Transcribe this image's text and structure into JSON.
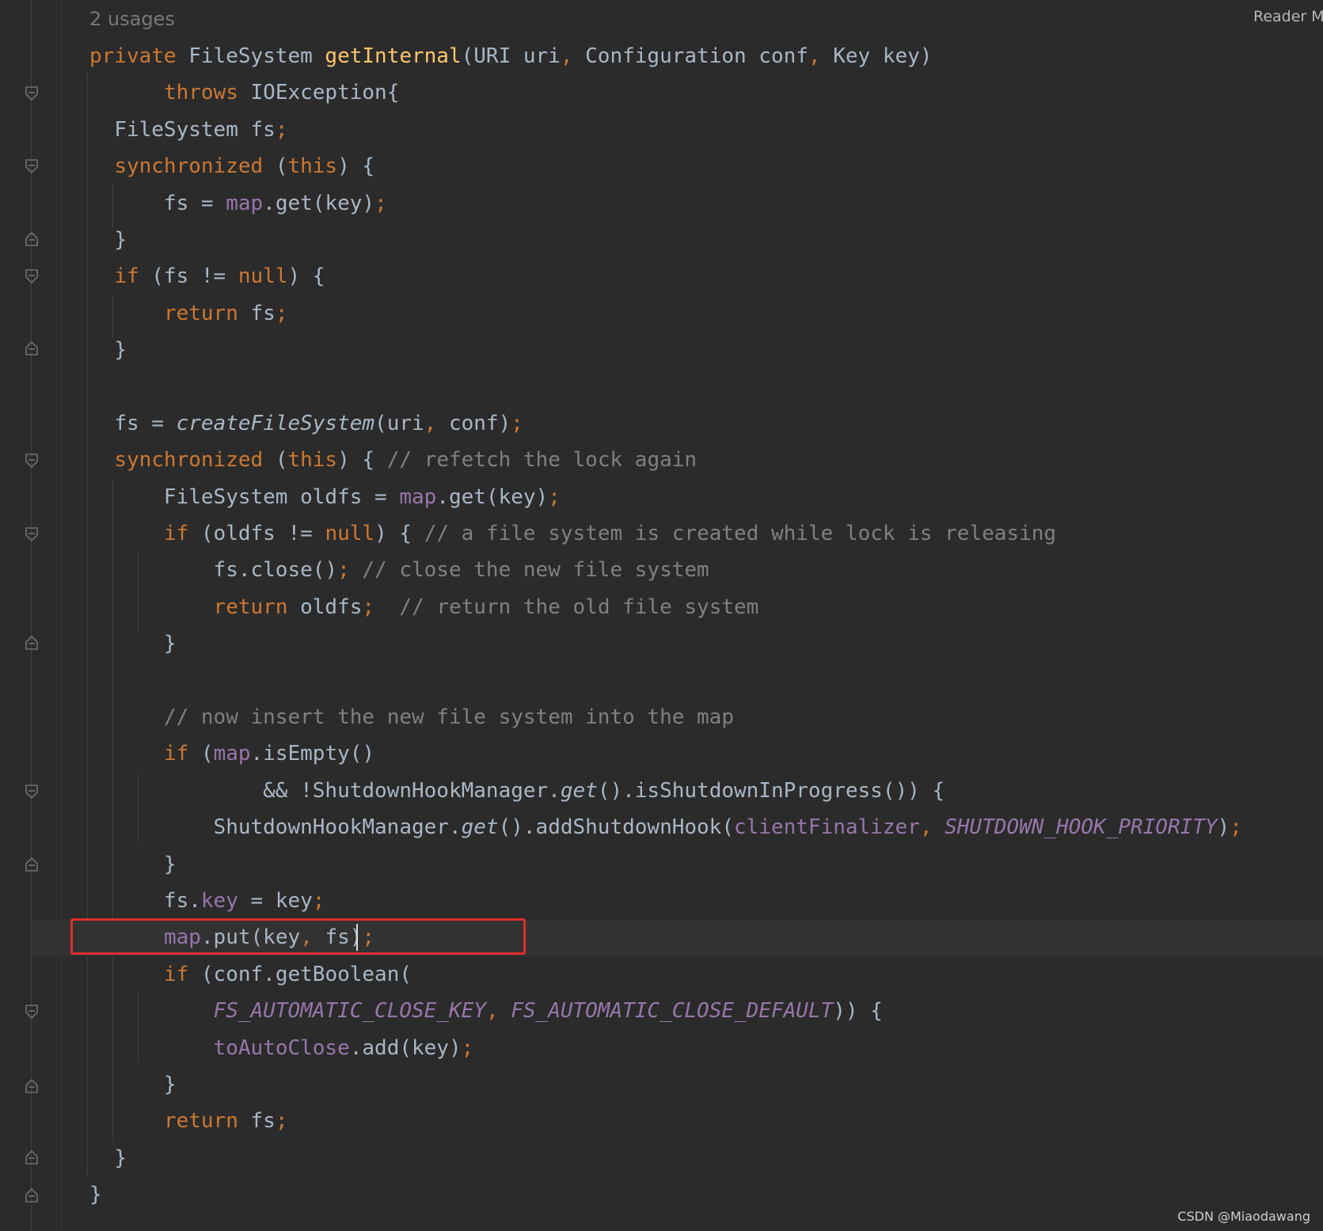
{
  "header": {
    "usages": "2 usages",
    "reader_mode": "Reader Mo"
  },
  "watermark": "CSDN @Miaodawang",
  "highlight": {
    "color": "#e02d2d",
    "line_text": "map.put(key, fs);"
  },
  "colors": {
    "background": "#2b2b2b",
    "keyword": "#cc7832",
    "method_decl": "#ffc66d",
    "field": "#9876aa",
    "comment": "#808080",
    "text": "#a9b7c6"
  },
  "code_lines": [
    [
      [
        "kw",
        "private "
      ],
      [
        "tx",
        "FileSystem "
      ],
      [
        "fn",
        "getInternal"
      ],
      [
        "tx",
        "(URI uri"
      ],
      [
        "pn",
        ", "
      ],
      [
        "tx",
        "Configuration conf"
      ],
      [
        "pn",
        ", "
      ],
      [
        "tx",
        "Key key)"
      ]
    ],
    [
      [
        "tx",
        "  "
      ],
      [
        "kw",
        "throws "
      ],
      [
        "tx",
        "IOException{"
      ]
    ],
    [
      [
        "tx",
        "FileSystem fs"
      ],
      [
        "pn",
        ";"
      ]
    ],
    [
      [
        "kw",
        "synchronized "
      ],
      [
        "tx",
        "("
      ],
      [
        "kw",
        "this"
      ],
      [
        "tx",
        ") {"
      ]
    ],
    [
      [
        "tx",
        "  fs = "
      ],
      [
        "fld",
        "map"
      ],
      [
        "tx",
        ".get(key)"
      ],
      [
        "pn",
        ";"
      ]
    ],
    [
      [
        "tx",
        "}"
      ]
    ],
    [
      [
        "kw",
        "if "
      ],
      [
        "tx",
        "(fs != "
      ],
      [
        "kw",
        "null"
      ],
      [
        "tx",
        ") {"
      ]
    ],
    [
      [
        "tx",
        "  "
      ],
      [
        "kw",
        "return "
      ],
      [
        "tx",
        "fs"
      ],
      [
        "pn",
        ";"
      ]
    ],
    [
      [
        "tx",
        "}"
      ]
    ],
    [],
    [
      [
        "tx",
        "fs = "
      ],
      [
        "it",
        "createFileSystem"
      ],
      [
        "tx",
        "(uri"
      ],
      [
        "pn",
        ", "
      ],
      [
        "tx",
        "conf)"
      ],
      [
        "pn",
        ";"
      ]
    ],
    [
      [
        "kw",
        "synchronized "
      ],
      [
        "tx",
        "("
      ],
      [
        "kw",
        "this"
      ],
      [
        "tx",
        ") { "
      ],
      [
        "cm",
        "// refetch the lock again"
      ]
    ],
    [
      [
        "tx",
        "  FileSystem oldfs = "
      ],
      [
        "fld",
        "map"
      ],
      [
        "tx",
        ".get(key)"
      ],
      [
        "pn",
        ";"
      ]
    ],
    [
      [
        "tx",
        "  "
      ],
      [
        "kw",
        "if "
      ],
      [
        "tx",
        "(oldfs != "
      ],
      [
        "kw",
        "null"
      ],
      [
        "tx",
        ") { "
      ],
      [
        "cm",
        "// a file system is created while lock is releasing"
      ]
    ],
    [
      [
        "tx",
        "    fs.close()"
      ],
      [
        "pn",
        "; "
      ],
      [
        "cm",
        "// close the new file system"
      ]
    ],
    [
      [
        "tx",
        "    "
      ],
      [
        "kw",
        "return "
      ],
      [
        "tx",
        "oldfs"
      ],
      [
        "pn",
        ";  "
      ],
      [
        "cm",
        "// return the old file system"
      ]
    ],
    [
      [
        "tx",
        "  }"
      ]
    ],
    [],
    [
      [
        "tx",
        "  "
      ],
      [
        "cm",
        "// now insert the new file system into the map"
      ]
    ],
    [
      [
        "tx",
        "  "
      ],
      [
        "kw",
        "if "
      ],
      [
        "tx",
        "("
      ],
      [
        "fld",
        "map"
      ],
      [
        "tx",
        ".isEmpty()"
      ]
    ],
    [
      [
        "tx",
        "          && !ShutdownHookManager."
      ],
      [
        "it",
        "get"
      ],
      [
        "tx",
        "().isShutdownInProgress()) {"
      ]
    ],
    [
      [
        "tx",
        "    ShutdownHookManager."
      ],
      [
        "it",
        "get"
      ],
      [
        "tx",
        "().addShutdownHook("
      ],
      [
        "fld",
        "clientFinalizer"
      ],
      [
        "pn",
        ", "
      ],
      [
        "cst",
        "SHUTDOWN_HOOK_PRIORITY"
      ],
      [
        "tx",
        ")"
      ],
      [
        "pn",
        ";"
      ]
    ],
    [
      [
        "tx",
        "  }"
      ]
    ],
    [
      [
        "tx",
        "  fs."
      ],
      [
        "fld",
        "key"
      ],
      [
        "tx",
        " = key"
      ],
      [
        "pn",
        ";"
      ]
    ],
    [
      [
        "tx",
        "  "
      ],
      [
        "fld",
        "map"
      ],
      [
        "tx",
        ".put(key"
      ],
      [
        "pn",
        ", "
      ],
      [
        "tx",
        "fs)"
      ],
      [
        "pn",
        ";"
      ]
    ],
    [
      [
        "tx",
        "  "
      ],
      [
        "kw",
        "if "
      ],
      [
        "tx",
        "(conf.getBoolean("
      ]
    ],
    [
      [
        "tx",
        "      "
      ],
      [
        "cst",
        "FS_AUTOMATIC_CLOSE_KEY"
      ],
      [
        "pn",
        ", "
      ],
      [
        "cst",
        "FS_AUTOMATIC_CLOSE_DEFAULT"
      ],
      [
        "tx",
        ")) {"
      ]
    ],
    [
      [
        "tx",
        "    "
      ],
      [
        "fld",
        "toAutoClose"
      ],
      [
        "tx",
        ".add(key)"
      ],
      [
        "pn",
        ";"
      ]
    ],
    [
      [
        "tx",
        "  }"
      ]
    ],
    [
      [
        "tx",
        "  "
      ],
      [
        "kw",
        "return "
      ],
      [
        "tx",
        "fs"
      ],
      [
        "pn",
        ";"
      ]
    ],
    [
      [
        "tx",
        "}"
      ]
    ],
    [
      [
        "tx",
        "}"
      ]
    ]
  ]
}
